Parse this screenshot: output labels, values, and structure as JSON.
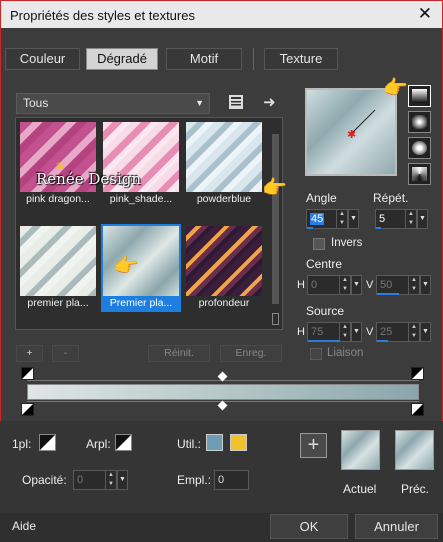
{
  "window": {
    "title": "Propriétés des styles et textures",
    "close": "✕"
  },
  "tabs": [
    {
      "label": "Couleur",
      "active": false
    },
    {
      "label": "Dégradé",
      "active": true
    },
    {
      "label": "Motif",
      "active": false
    },
    {
      "label": "Texture",
      "active": false
    }
  ],
  "category": {
    "value": "Tous"
  },
  "gallery": {
    "items": [
      {
        "label": "pink dragon...",
        "selected": false
      },
      {
        "label": "pink_shade...",
        "selected": false
      },
      {
        "label": "powderblue",
        "selected": false
      },
      {
        "label": "premier pla...",
        "selected": false
      },
      {
        "label": "Premier pla...",
        "selected": true
      },
      {
        "label": "profondeur",
        "selected": false
      }
    ],
    "watermark": "Renée Design"
  },
  "gallery_buttons": {
    "add": "+",
    "remove": "-",
    "reset": "Réinit.",
    "save": "Enreg."
  },
  "angle": {
    "label": "Angle",
    "value": "45"
  },
  "repeat": {
    "label": "Répét.",
    "value": "5"
  },
  "invert": {
    "label": "Invers",
    "checked": false
  },
  "center": {
    "label": "Centre",
    "h_label": "H",
    "h_value": "0",
    "v_label": "V",
    "v_value": "50"
  },
  "source": {
    "label": "Source",
    "h_label": "H",
    "h_value": "75",
    "v_label": "V",
    "v_value": "25"
  },
  "link": {
    "label": "Liaison",
    "checked": false
  },
  "bottom": {
    "opl_label": "1pl:",
    "arpl_label": "Arpl:",
    "util_label": "Util.:",
    "opacity_label": "Opacité:",
    "opacity_value": "0",
    "empl_label": "Empl.:",
    "empl_value": "0",
    "current_label": "Actuel",
    "previous_label": "Préc.",
    "add_label": "+",
    "util_colors": [
      "#6f9db5",
      "#f2c12e"
    ]
  },
  "footer": {
    "help": "Aide",
    "ok": "OK",
    "cancel": "Annuler"
  },
  "colors": {
    "accent": "#2a7de1",
    "border": "#c62828",
    "selected": "#1e7ee0"
  }
}
